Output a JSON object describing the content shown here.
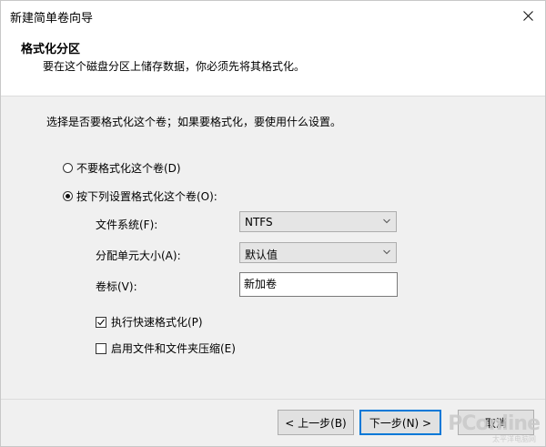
{
  "window": {
    "title": "新建简单卷向导",
    "close_icon": "close-icon"
  },
  "header": {
    "title": "格式化分区",
    "description": "要在这个磁盘分区上储存数据，你必须先将其格式化。"
  },
  "body": {
    "instruction": "选择是否要格式化这个卷；如果要格式化，要使用什么设置。",
    "radio_no_format": {
      "label": "不要格式化这个卷(D)",
      "checked": false
    },
    "radio_format": {
      "label": "按下列设置格式化这个卷(O):",
      "checked": true
    },
    "file_system": {
      "label": "文件系统(F):",
      "value": "NTFS"
    },
    "allocation_unit": {
      "label": "分配单元大小(A):",
      "value": "默认值"
    },
    "volume_label": {
      "label": "卷标(V):",
      "value": "新加卷"
    },
    "quick_format": {
      "label": "执行快速格式化(P)",
      "checked": true
    },
    "compression": {
      "label": "启用文件和文件夹压缩(E)",
      "checked": false
    }
  },
  "footer": {
    "back_label": "< 上一步(B)",
    "next_label": "下一步(N) >",
    "cancel_label": "取消"
  },
  "watermark": {
    "text": "PConline",
    "sub": "太平洋电脑网"
  },
  "colors": {
    "primary_border": "#0078d7",
    "background": "#f0f0f0"
  }
}
